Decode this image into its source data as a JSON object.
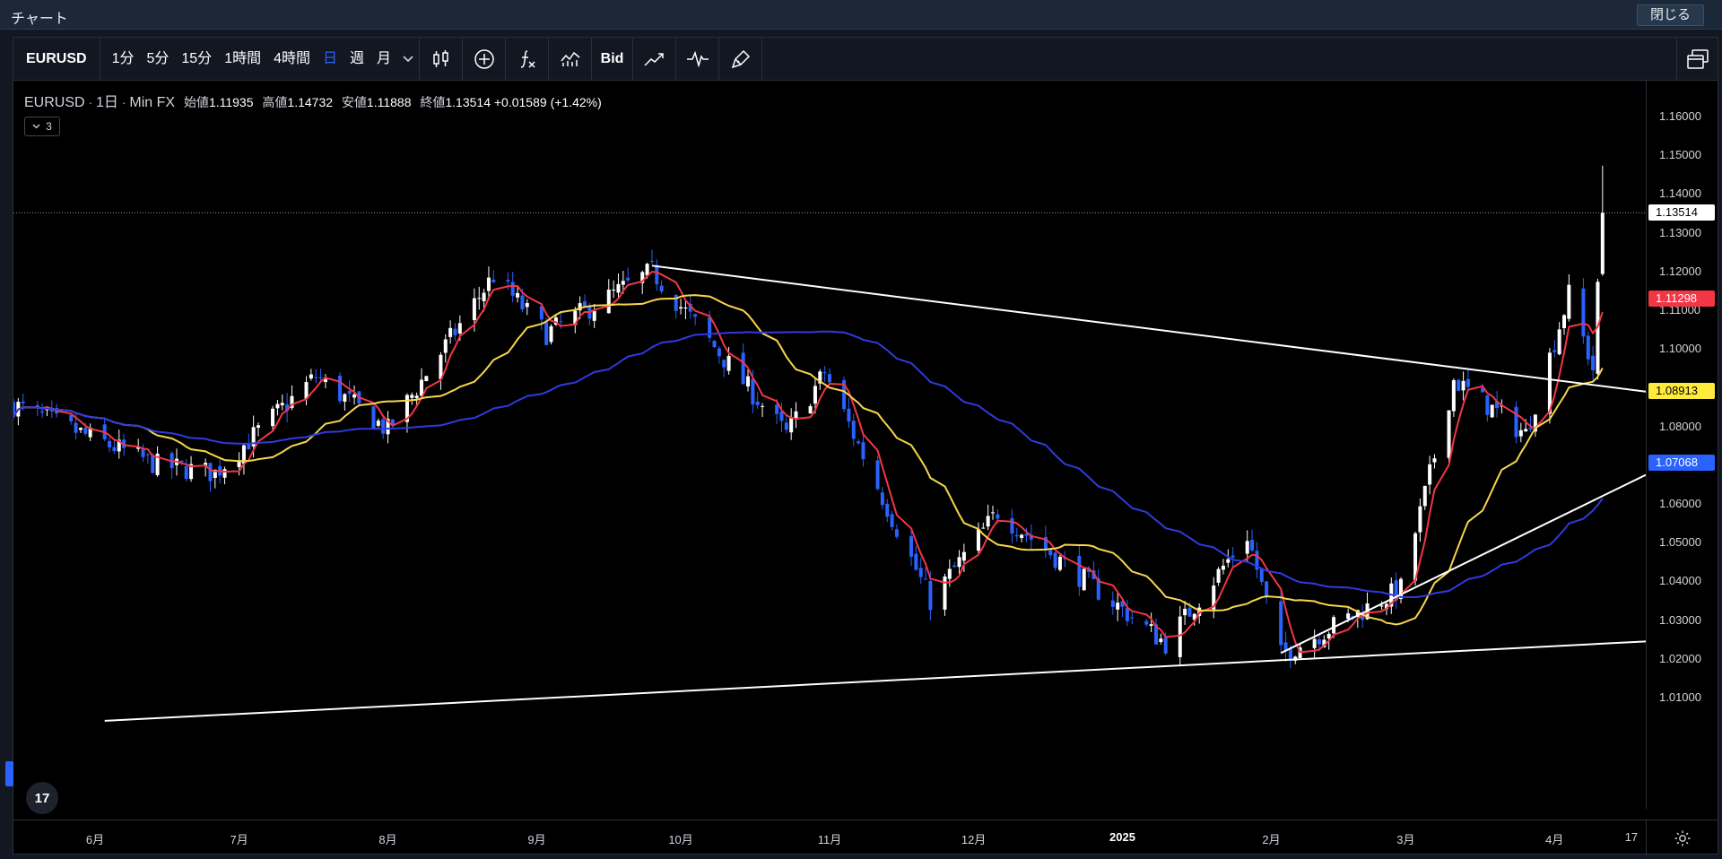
{
  "window": {
    "title": "チャート",
    "close_label": "閉じる"
  },
  "toolbar": {
    "symbol": "EURUSD",
    "intervals": [
      {
        "label": "1分",
        "active": false
      },
      {
        "label": "5分",
        "active": false
      },
      {
        "label": "15分",
        "active": false
      },
      {
        "label": "1時間",
        "active": false
      },
      {
        "label": "4時間",
        "active": false
      },
      {
        "label": "日",
        "active": true
      },
      {
        "label": "週",
        "active": false
      },
      {
        "label": "月",
        "active": false
      }
    ],
    "dropdown_icon": "chevron-down-icon",
    "price_type_label": "Bid",
    "buttons": [
      "candlestick-icon",
      "add-indicator-icon",
      "formula-icon",
      "compare-icon",
      "bid-toggle",
      "trend-icon",
      "replay-icon",
      "brush-icon"
    ],
    "layout_icon": "multi-window-icon"
  },
  "legend": {
    "symbol": "EURUSD",
    "interval": "1日",
    "source": "Min FX",
    "open_label": "始値",
    "open": "1.11935",
    "high_label": "高値",
    "high": "1.14732",
    "low_label": "安値",
    "low": "1.11888",
    "close_label": "終値",
    "close": "1.13514",
    "change": "+0.01589",
    "change_pct": "(+1.42%)",
    "indicator_count": "3"
  },
  "price_scale": {
    "ticks": [
      "1.16000",
      "1.15000",
      "1.14000",
      "1.13000",
      "1.12000",
      "1.11000",
      "1.10000",
      "1.09000",
      "1.08000",
      "1.07000",
      "1.06000",
      "1.05000",
      "1.04000",
      "1.03000",
      "1.02000",
      "1.01000"
    ],
    "last_price": {
      "value": "1.13514",
      "bg": "#ffffff",
      "fg": "#000000"
    },
    "ma_fast": {
      "value": "1.11298",
      "bg": "#f23645",
      "fg": "#ffffff"
    },
    "ma_mid": {
      "value": "1.08913",
      "bg": "#ffeb3b",
      "fg": "#000000"
    },
    "ma_slow": {
      "value": "1.07068",
      "bg": "#2962ff",
      "fg": "#ffffff"
    }
  },
  "time_scale": {
    "ticks": [
      {
        "label": "6月",
        "bold": false
      },
      {
        "label": "7月",
        "bold": false
      },
      {
        "label": "8月",
        "bold": false
      },
      {
        "label": "9月",
        "bold": false
      },
      {
        "label": "10月",
        "bold": false
      },
      {
        "label": "11月",
        "bold": false
      },
      {
        "label": "12月",
        "bold": false
      },
      {
        "label": "2025",
        "bold": true
      },
      {
        "label": "2月",
        "bold": false
      },
      {
        "label": "3月",
        "bold": false
      },
      {
        "label": "4月",
        "bold": false
      },
      {
        "label": "17",
        "bold": false
      }
    ],
    "settings_icon": "gear-icon"
  },
  "colors": {
    "up": "#ffffff",
    "down": "#2962ff",
    "ma_fast": "#f23645",
    "ma_mid": "#f7d64a",
    "ma_slow": "#2f3adf",
    "trendline": "#ffffff",
    "background": "#000000"
  },
  "chart_data": {
    "type": "candlestick",
    "symbol": "EURUSD",
    "interval": "1日",
    "ylim": [
      1.005,
      1.165
    ],
    "x_range": [
      "2024-05-15",
      "2025-04-20"
    ],
    "last_price": 1.13514,
    "series_keypoints": [
      {
        "date": "2024-05-15",
        "close": 1.0855
      },
      {
        "date": "2024-06-14",
        "close": 1.07
      },
      {
        "date": "2024-06-26",
        "close": 1.068
      },
      {
        "date": "2024-07-17",
        "close": 1.093
      },
      {
        "date": "2024-08-01",
        "close": 1.079
      },
      {
        "date": "2024-08-23",
        "close": 1.119
      },
      {
        "date": "2024-09-03",
        "close": 1.104
      },
      {
        "date": "2024-09-25",
        "close": 1.12
      },
      {
        "date": "2024-10-23",
        "close": 1.078
      },
      {
        "date": "2024-10-31",
        "close": 1.094
      },
      {
        "date": "2024-11-22",
        "close": 1.035
      },
      {
        "date": "2024-12-06",
        "close": 1.058
      },
      {
        "date": "2025-01-10",
        "close": 1.024
      },
      {
        "date": "2025-01-27",
        "close": 1.052
      },
      {
        "date": "2025-02-03",
        "close": 1.021
      },
      {
        "date": "2025-02-28",
        "close": 1.038
      },
      {
        "date": "2025-03-11",
        "close": 1.092
      },
      {
        "date": "2025-03-26",
        "close": 1.078
      },
      {
        "date": "2025-04-04",
        "close": 1.114
      },
      {
        "date": "2025-04-09",
        "close": 1.095
      },
      {
        "date": "2025-04-11",
        "close": 1.13514
      }
    ],
    "trendlines": [
      {
        "from": {
          "date": "2024-09-25",
          "price": 1.1215
        },
        "to": {
          "date": "2025-04-20",
          "price": 1.089
        }
      },
      {
        "from": {
          "date": "2024-06-03",
          "price": 1.004
        },
        "to": {
          "date": "2025-04-20",
          "price": 1.0245
        }
      },
      {
        "from": {
          "date": "2025-02-03",
          "price": 1.0215
        },
        "to": {
          "date": "2025-04-20",
          "price": 1.0675
        }
      }
    ]
  }
}
